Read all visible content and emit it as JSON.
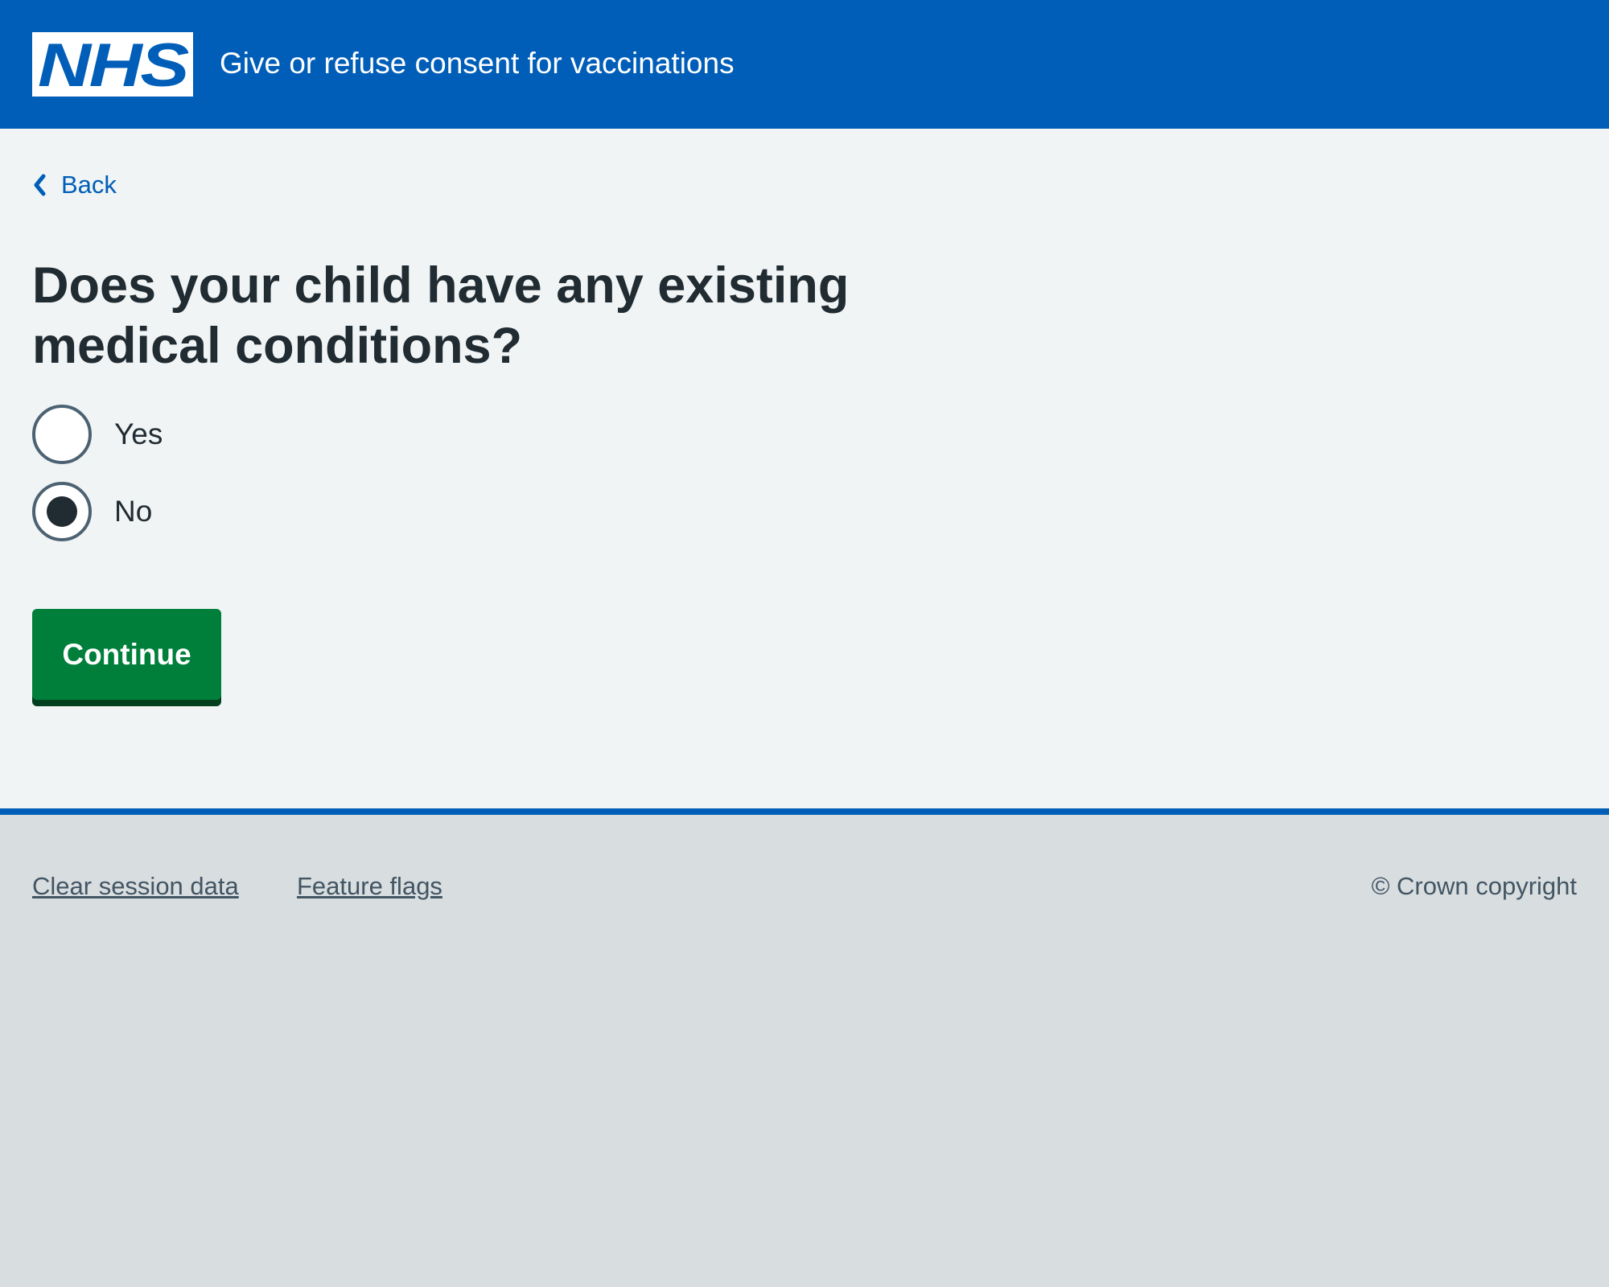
{
  "header": {
    "logo_text": "NHS",
    "service_name": "Give or refuse consent for vaccinations"
  },
  "back_link": {
    "label": "Back",
    "icon": "chevron-left-icon"
  },
  "question": {
    "title": "Does your child have any existing medical conditions?",
    "options": [
      {
        "label": "Yes",
        "selected": false
      },
      {
        "label": "No",
        "selected": true
      }
    ]
  },
  "continue_button": {
    "label": "Continue"
  },
  "footer": {
    "links": [
      {
        "label": "Clear session data"
      },
      {
        "label": "Feature flags"
      }
    ],
    "copyright": "© Crown copyright"
  },
  "colors": {
    "nhs_blue": "#005eb8",
    "page_background": "#f0f4f5",
    "footer_background": "#d8dde0",
    "text": "#212b32",
    "secondary_text": "#425563",
    "button_green": "#007f3b",
    "button_shadow": "#00401e",
    "radio_border": "#4c6272"
  }
}
